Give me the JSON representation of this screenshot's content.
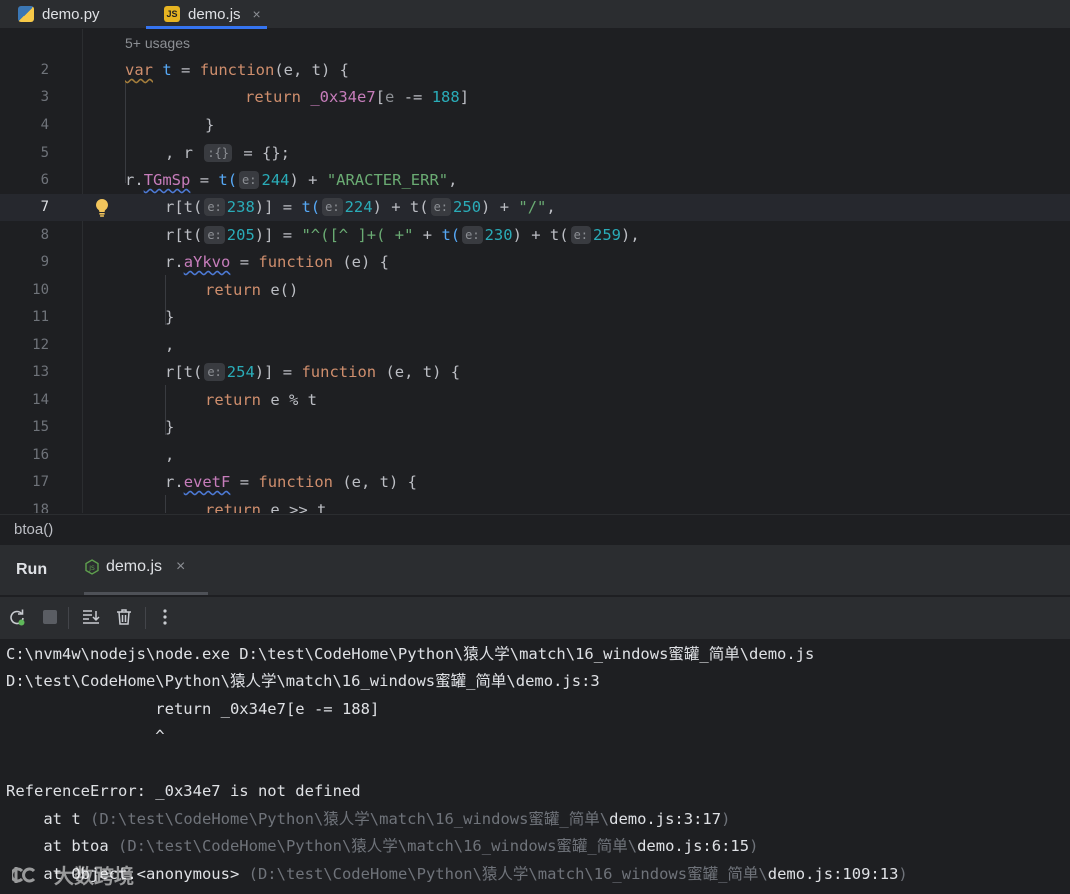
{
  "tabs": [
    {
      "label": "demo.py",
      "icon": "python-file-icon",
      "active": false
    },
    {
      "label": "demo.js",
      "icon": "javascript-file-icon",
      "active": true,
      "close": "×"
    }
  ],
  "editor": {
    "usages": "5+ usages",
    "line_numbers": [
      "2",
      "3",
      "4",
      "5",
      "6",
      "7",
      "8",
      "9",
      "10",
      "11",
      "12",
      "13",
      "14",
      "15",
      "16",
      "17",
      "18"
    ],
    "hints": {
      "e": "e:",
      "obj": ":{}"
    },
    "tokens": {
      "var": "var",
      "t": "t",
      "eq": " = ",
      "function": "function",
      "args_et": "(e, t) {",
      "return": "return",
      "arr": "_0x34e7",
      "idx_open": "[",
      "e": "e",
      "minus_eq": " -= ",
      "n188": "188",
      "bracket_close": "]",
      "brace_close": "}",
      "comma_r": ", r ",
      "eq_obj": " = {};",
      "r": "r",
      "dot": ".",
      "TGmSp": "TGmSp",
      "call_t": "t(",
      "n244": "244",
      "close_paren_plus": ") + ",
      "str_aracter": "\"ARACTER_ERR\"",
      "comma": ",",
      "r_bracket_t": "r[t(",
      "n238": "238",
      "close_bracket_eq": ")] = ",
      "n224": "224",
      "plus_t": ") + t(",
      "n250": "250",
      "str_slash": "\"/\"",
      "n205": "205",
      "str_regex": "\"^([^ ]+( +\"",
      "plus": " + ",
      "n230": "230",
      "n259": "259",
      "close_paren_comma": "),",
      "aYkvo": "aYkvo",
      "args_e": " (e) {",
      "call_e": "e()",
      "n254": "254",
      "args_et2": " (e, t) {",
      "mod": "e % t",
      "evetF": "evetF",
      "shift": "e >> t"
    }
  },
  "breadcrumb": "btoa()",
  "run": {
    "title": "Run",
    "tab": "demo.js",
    "close": "×"
  },
  "toolbar": [
    {
      "name": "rerun-icon"
    },
    {
      "name": "stop-icon"
    },
    {
      "name": "scroll-to-end-icon"
    },
    {
      "name": "trash-icon"
    },
    {
      "name": "more-icon"
    }
  ],
  "console": {
    "lines": [
      "C:\\nvm4w\\nodejs\\node.exe D:\\test\\CodeHome\\Python\\猿人学\\match\\16_windows蜜罐_简单\\demo.js",
      "D:\\test\\CodeHome\\Python\\猿人学\\match\\16_windows蜜罐_简单\\demo.js:3",
      "                return _0x34e7[e -= 188]",
      "                ^",
      "",
      "ReferenceError: _0x34e7 is not defined"
    ],
    "stack": [
      {
        "at": "    at t ",
        "path": "(D:\\test\\CodeHome\\Python\\猿人学\\match\\16_windows蜜罐_简单\\",
        "file": "demo.js:3:17",
        "end": ")"
      },
      {
        "at": "    at btoa ",
        "path": "(D:\\test\\CodeHome\\Python\\猿人学\\match\\16_windows蜜罐_简单\\",
        "file": "demo.js:6:15",
        "end": ")"
      },
      {
        "at": "    at Object.<anonymous> ",
        "path": "(D:\\test\\CodeHome\\Python\\猿人学\\match\\16_windows蜜罐_简单\\",
        "file": "demo.js:109:13",
        "end": ")"
      }
    ]
  },
  "watermark": "大数跨境",
  "colors": {
    "accent": "#3574f0",
    "bulb": "#f2c55c",
    "keyword": "#cf8e6d",
    "number": "#2aacb8",
    "string": "#6aab73"
  }
}
